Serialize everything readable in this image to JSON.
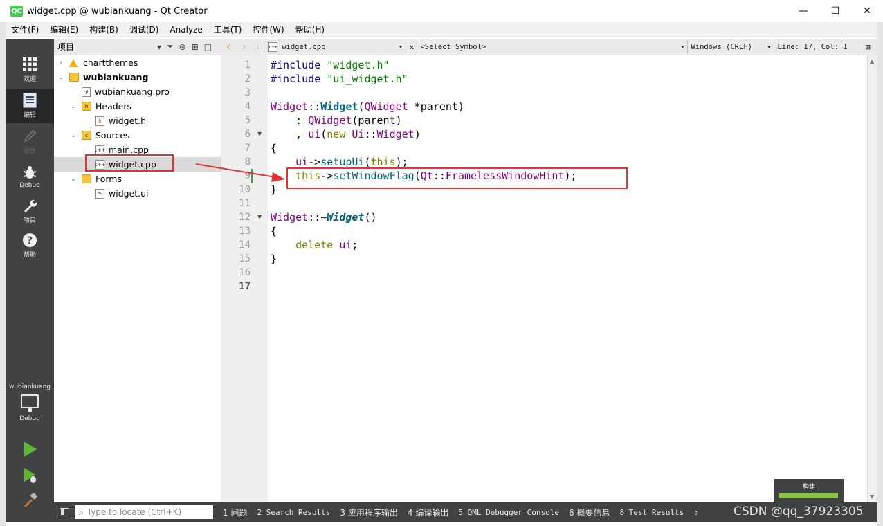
{
  "window": {
    "logo": "QC",
    "title": "widget.cpp @ wubiankuang - Qt Creator",
    "minimize": "—",
    "maximize": "☐",
    "close": "✕"
  },
  "menu": [
    "文件(F)",
    "编辑(E)",
    "构建(B)",
    "调试(D)",
    "Analyze",
    "工具(T)",
    "控件(W)",
    "帮助(H)"
  ],
  "modes": [
    {
      "label": "欢迎",
      "icon": "grid-icon"
    },
    {
      "label": "编辑",
      "icon": "document-icon"
    },
    {
      "label": "设计",
      "icon": "pencil-icon"
    },
    {
      "label": "Debug",
      "icon": "bug-icon"
    },
    {
      "label": "项目",
      "icon": "wrench-icon"
    },
    {
      "label": "帮助",
      "icon": "help-icon"
    }
  ],
  "kit": {
    "project": "wubiankuang",
    "build_config": "Debug"
  },
  "project_panel": {
    "title": "项目",
    "tree": [
      {
        "label": "chartthemes",
        "depth": 0,
        "expander": "›",
        "icon": "warning-icon"
      },
      {
        "label": "wubiankuang",
        "depth": 0,
        "expander": "⌄",
        "icon": "project-folder-icon",
        "bold": true
      },
      {
        "label": "wubiankuang.pro",
        "depth": 1,
        "expander": "",
        "icon": "pro-file-icon"
      },
      {
        "label": "Headers",
        "depth": 1,
        "expander": "⌄",
        "icon": "headers-folder-icon"
      },
      {
        "label": "widget.h",
        "depth": 2,
        "expander": "",
        "icon": "header-file-icon"
      },
      {
        "label": "Sources",
        "depth": 1,
        "expander": "⌄",
        "icon": "sources-folder-icon"
      },
      {
        "label": "main.cpp",
        "depth": 2,
        "expander": "",
        "icon": "cpp-file-icon"
      },
      {
        "label": "widget.cpp",
        "depth": 2,
        "expander": "",
        "icon": "cpp-file-icon",
        "selected": true
      },
      {
        "label": "Forms",
        "depth": 1,
        "expander": "⌄",
        "icon": "forms-folder-icon"
      },
      {
        "label": "widget.ui",
        "depth": 2,
        "expander": "",
        "icon": "ui-file-icon"
      }
    ]
  },
  "editor_toolbar": {
    "file": "widget.cpp",
    "symbol": "<Select Symbol>",
    "line_endings": "Windows (CRLF)",
    "position": "Line: 17, Col: 1"
  },
  "code_lines": [
    {
      "n": "1"
    },
    {
      "n": "2"
    },
    {
      "n": "3"
    },
    {
      "n": "4"
    },
    {
      "n": "5"
    },
    {
      "n": "6",
      "fold": true
    },
    {
      "n": "7"
    },
    {
      "n": "8"
    },
    {
      "n": "9"
    },
    {
      "n": "10"
    },
    {
      "n": "11"
    },
    {
      "n": "12",
      "fold": true
    },
    {
      "n": "13"
    },
    {
      "n": "14"
    },
    {
      "n": "15"
    },
    {
      "n": "16"
    },
    {
      "n": "17",
      "current": true
    }
  ],
  "code": {
    "l1_pp": "#include",
    "l1_str": "\"widget.h\"",
    "l2_pp": "#include",
    "l2_str": "\"ui_widget.h\"",
    "l4_cls": "Widget",
    "l4_sep": "::",
    "l4_fn": "Widget",
    "l4_open": "(",
    "l4_type": "QWidget",
    "l4_rest": " *parent)",
    "l5_colon": "    : ",
    "l5_type": "QWidget",
    "l5_rest": "(parent)",
    "l6_comma": "    , ",
    "l6_member": "ui",
    "l6_open": "(",
    "l6_new": "new",
    "l6_space": " ",
    "l6_ns": "Ui",
    "l6_sep": "::",
    "l6_cls": "Widget",
    "l6_close": ")",
    "l7": "{",
    "l8_indent": "    ",
    "l8_member": "ui",
    "l8_arrow": "->",
    "l8_fn": "setupUi",
    "l8_open": "(",
    "l8_this": "this",
    "l8_close": ");",
    "l9_indent": "    ",
    "l9_this": "this",
    "l9_arrow": "->",
    "l9_fn": "setWindowFlag",
    "l9_open": "(",
    "l9_ns": "Qt",
    "l9_sep": "::",
    "l9_enum": "FramelessWindowHint",
    "l9_close": ");",
    "l10": "}",
    "l12_cls": "Widget",
    "l12_sep": "::~",
    "l12_fn": "Widget",
    "l12_rest": "()",
    "l13": "{",
    "l14_indent": "    ",
    "l14_kw": "delete",
    "l14_space": " ",
    "l14_member": "ui",
    "l14_semi": ";",
    "l15": "}"
  },
  "build_progress": {
    "label": "构建",
    "fraction": 1.0,
    "color": "#8bc34a"
  },
  "bottom_bar": {
    "locator_placeholder": "Type to locate (Ctrl+K)",
    "tabs": [
      "1 问题",
      "2 Search Results",
      "3 应用程序输出",
      "4 编译输出",
      "5 QML Debugger Console",
      "6 概要信息",
      "8 Test Results"
    ]
  },
  "watermark": "CSDN @qq_37923305",
  "colors": {
    "modebar": "#404244",
    "annotation": "#e03434",
    "keyword": "#808000",
    "string": "#008000",
    "type": "#800080",
    "function": "#00677c"
  }
}
